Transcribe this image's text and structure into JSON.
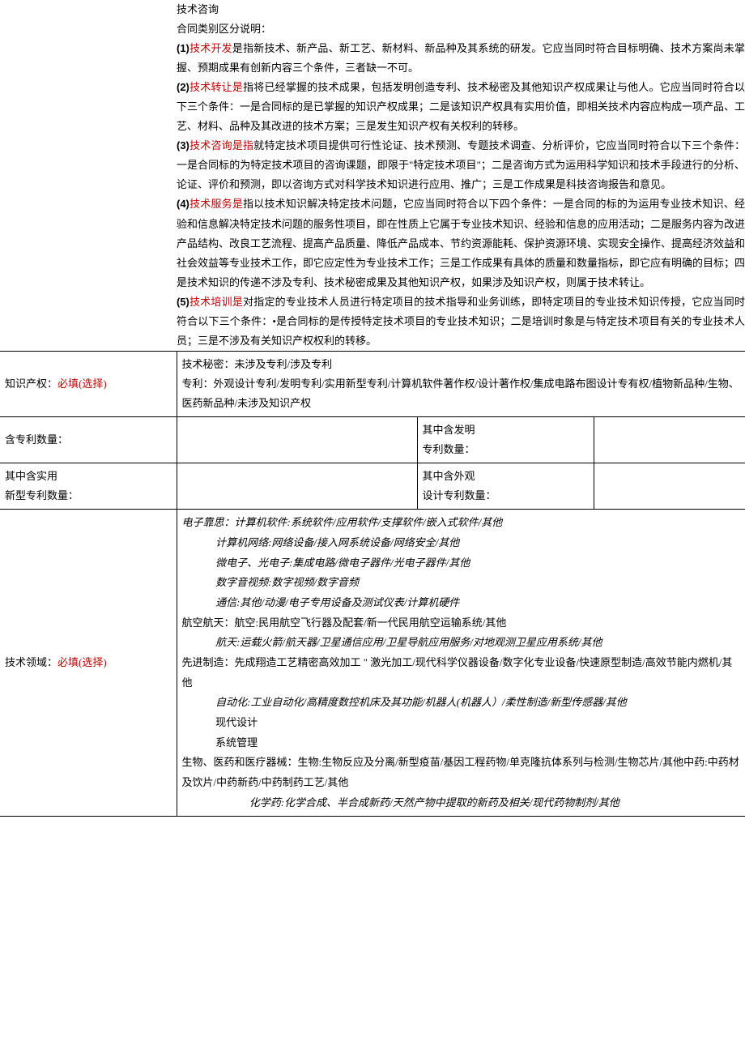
{
  "intro": {
    "line0": "技术咨询",
    "line1": "合同类别区分说明：",
    "p1num": "(1)",
    "p1term": "技术开发",
    "p1rest": "是指新技术、新产品、新工艺、新材料、新品种及其系统的研发。它应当同时符合目标明确、技术方案尚未掌握、预期成果有创新内容三个条件，三者缺一不可。",
    "p2num": "(2)",
    "p2term": "技术转让是",
    "p2rest": "指将已经掌握的技术成果，包括发明创造专利、技术秘密及其他知识产权成果让与他人。它应当同时符合以下三个条件：一是合同标的是已掌握的知识产权成果；二是该知识产权具有实用价值，即相关技术内容应构成一项产品、工艺、材料、品种及其改进的技术方案；三是发生知识产权有关权利的转移。",
    "p3num": "(3)",
    "p3term": "技术咨询是指",
    "p3rest": "就特定技术项目提供可行性论证、技术预测、专题技术调查、分析评价，它应当同时符合以下三个条件：一是合同标的为特定技术项目的咨询课题，即限于\"特定技术项目\"；二是咨询方式为运用科学知识和技术手段进行的分析、论证、评价和预测，即以咨询方式对科学技术知识进行应用、推广；三是工作成果是科技咨询报告和意见。",
    "p4num": "(4)",
    "p4term": "技术服务是",
    "p4rest": "指以技术知识解决特定技术问题，它应当同时符合以下四个条件：一是合同的标的为运用专业技术知识、经验和信息解决特定技术问题的服务性项目，即在性质上它属于专业技术知识、经验和信息的应用活动；二是服务内容为改进产品结构、改良工艺流程、提高产品质量、降低产品成本、节约资源能耗、保护资源环境、实现安全操作、提高经济效益和社会效益等专业技术工作，即它应定性为专业技术工作；三是工作成果有具体的质量和数量指标，即它应有明确的目标；四是技术知识的传递不涉及专利、技术秘密成果及其他知识产权，如果涉及知识产权，则属于技术转让。",
    "p5num": "(5)",
    "p5term": "技术培训是",
    "p5rest": "对指定的专业技术人员进行特定项目的技术指导和业务训练，即特定项目的专业技术知识传授，它应当同时符合以下三个条件：•是合同标的是传授特定技术项目的专业技术知识；二是培训时象是与特定技术项目有关的专业技术人员；三是不涉及有关知识产权权利的转移。"
  },
  "table": {
    "row_ip_label_main": "知识产权：",
    "row_ip_label_req": "必填(选择)",
    "row_ip_value": "技术秘密：未涉及专利/涉及专利\n专利：外观设计专利/发明专利/实用新型专利/计算机软件著作权/设计著作权/集成电路布图设计专有权/植物新品种/生物、医药新品种/未涉及知识产权",
    "row_patent_count_label": "含专利数量：",
    "row_patent_inv_label": "其中含发明\n专利数量：",
    "row_patent_util_label": "其中含实用\n新型专利数量：",
    "row_patent_design_label": "其中含外观\n设计专利数量：",
    "row_domain_label_main": "技术领域：",
    "row_domain_label_req": "必填(选择)",
    "domain": {
      "l1": "电子靠思：计算机软件:系统软件/应用软件/支撑软件/嵌入式软件/其他",
      "l2": "计算机网络:网络设备/接入网系统设备/网络安全/其他",
      "l3": "微电子、光电子:集成电路/微电子器件/光电子器件/其他",
      "l4": "数字音视频:数字视频/数字音频",
      "l5": "通信:其他/动漫/电子专用设备及测试仪表/计算机硬件",
      "l6": "航空航天：航空:民用航空飞行器及配套/新一代民用航空运输系统/其他",
      "l7": "航天:运载火箭/航天器/卫星通信应用/卫星导航应用服务/对地观测卫星应用系统/其他",
      "l8": "先进制造：先成翔造工艺精密高效加工 \" 激光加工/现代科学仪器设备/数字化专业设备/快速原型制造/高效节能内燃机/其他",
      "l9": "自动化:工业自动化/高精度数控机床及其功能/机器人(机器人）/柔性制造/新型传感器/其他",
      "l10": "现代设计",
      "l11": "系统管理",
      "l12": "生物、医药和医疗器械：生物:生物反应及分离/新型疫苗/基因工程药物/单克隆抗体系列与检测/生物芯片/其他中药:中药材及饮片/中药新药/中药制药工艺/其他",
      "l13": "化学药:化学合成、半合成新药/天然产物中提取的新药及相关/现代药物制剂/其他"
    }
  }
}
